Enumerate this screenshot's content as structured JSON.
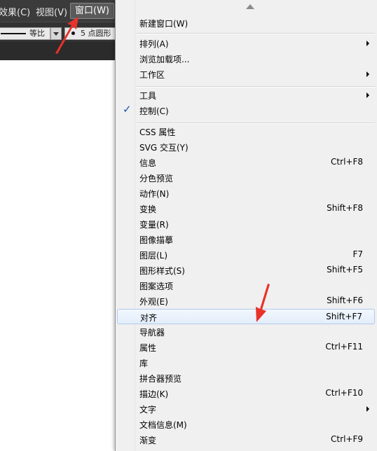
{
  "menubar": {
    "items": [
      {
        "label": "效果(C)"
      },
      {
        "label": "视图(V)"
      },
      {
        "label": "窗口(W)"
      }
    ]
  },
  "controlbar": {
    "stroke_style_label": "等比",
    "point_label": "5 点圆形"
  },
  "menu": {
    "items": [
      {
        "label": "新建窗口(W)",
        "shortcut": "",
        "submenu": false,
        "checked": false
      },
      {
        "label": "排列(A)",
        "shortcut": "",
        "submenu": true,
        "checked": false
      },
      {
        "label": "浏览加载项...",
        "shortcut": "",
        "submenu": false,
        "checked": false
      },
      {
        "label": "工作区",
        "shortcut": "",
        "submenu": true,
        "checked": false
      },
      {
        "label": "工具",
        "shortcut": "",
        "submenu": true,
        "checked": false
      },
      {
        "label": "控制(C)",
        "shortcut": "",
        "submenu": false,
        "checked": true
      },
      {
        "label": "CSS 属性",
        "shortcut": "",
        "submenu": false,
        "checked": false
      },
      {
        "label": "SVG 交互(Y)",
        "shortcut": "",
        "submenu": false,
        "checked": false
      },
      {
        "label": "信息",
        "shortcut": "Ctrl+F8",
        "submenu": false,
        "checked": false
      },
      {
        "label": "分色预览",
        "shortcut": "",
        "submenu": false,
        "checked": false
      },
      {
        "label": "动作(N)",
        "shortcut": "",
        "submenu": false,
        "checked": false
      },
      {
        "label": "变换",
        "shortcut": "Shift+F8",
        "submenu": false,
        "checked": false
      },
      {
        "label": "变量(R)",
        "shortcut": "",
        "submenu": false,
        "checked": false
      },
      {
        "label": "图像描摹",
        "shortcut": "",
        "submenu": false,
        "checked": false
      },
      {
        "label": "图层(L)",
        "shortcut": "F7",
        "submenu": false,
        "checked": false
      },
      {
        "label": "图形样式(S)",
        "shortcut": "Shift+F5",
        "submenu": false,
        "checked": false
      },
      {
        "label": "图案选项",
        "shortcut": "",
        "submenu": false,
        "checked": false
      },
      {
        "label": "外观(E)",
        "shortcut": "Shift+F6",
        "submenu": false,
        "checked": false
      },
      {
        "label": "对齐",
        "shortcut": "Shift+F7",
        "submenu": false,
        "checked": false,
        "highlighted": true
      },
      {
        "label": "导航器",
        "shortcut": "",
        "submenu": false,
        "checked": false
      },
      {
        "label": "属性",
        "shortcut": "Ctrl+F11",
        "submenu": false,
        "checked": false
      },
      {
        "label": "库",
        "shortcut": "",
        "submenu": false,
        "checked": false
      },
      {
        "label": "拼合器预览",
        "shortcut": "",
        "submenu": false,
        "checked": false
      },
      {
        "label": "描边(K)",
        "shortcut": "Ctrl+F10",
        "submenu": false,
        "checked": false
      },
      {
        "label": "文字",
        "shortcut": "",
        "submenu": true,
        "checked": false
      },
      {
        "label": "文档信息(M)",
        "shortcut": "",
        "submenu": false,
        "checked": false
      },
      {
        "label": "渐变",
        "shortcut": "Ctrl+F9",
        "submenu": false,
        "checked": false
      }
    ],
    "check_glyph": "✓"
  },
  "colors": {
    "menubar_bg": "#3b3b3b",
    "menu_bg": "#f0f0f0",
    "hover_border": "#aecbef",
    "annotation_arrow": "#e8322a"
  }
}
